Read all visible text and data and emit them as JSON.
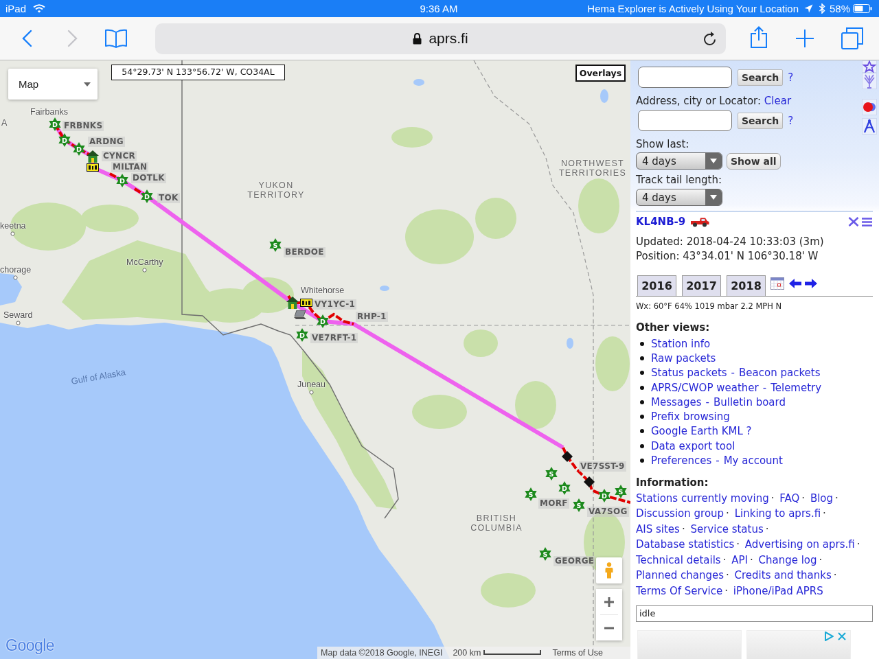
{
  "status_bar": {
    "device": "iPad",
    "time": "9:36 AM",
    "notice": "Hema Explorer is Actively Using Your Location",
    "battery": "58%"
  },
  "browser": {
    "nav": [
      {
        "kind": "back",
        "disabled": false
      },
      {
        "kind": "forward",
        "disabled": true
      }
    ],
    "address": "aprs.fi"
  },
  "map": {
    "type_menu": "Map",
    "coordinates": "54°29.73' N 133°56.72' W, CO34AL",
    "overlays": "Overlays",
    "places": [
      {
        "name": "Fairbanks",
        "kind": "city"
      },
      {
        "name": "A",
        "kind": "city"
      },
      {
        "name": "NORTHWEST TERRITORIES",
        "kind": "region"
      },
      {
        "name": "YUKON TERRITORY",
        "kind": "region"
      },
      {
        "name": "keetna",
        "kind": "town"
      },
      {
        "name": "McCarthy",
        "kind": "town"
      },
      {
        "name": "chorage",
        "kind": "town"
      },
      {
        "name": "Whitehorse",
        "kind": "city"
      },
      {
        "name": "Seward",
        "kind": "town"
      },
      {
        "name": "Gulf of Alaska",
        "kind": "water"
      },
      {
        "name": "Juneau",
        "kind": "town"
      },
      {
        "name": "BRITISH COLUMBIA",
        "kind": "region"
      }
    ],
    "station_labels": [
      "FRBNKS",
      "ARDNG",
      "CYNCR",
      "MILTAN",
      "DOTLK",
      "TOK",
      "BERDOE",
      "VY1YC-1",
      "RHP-1",
      "VE7RFT-1",
      "VE7SST-9",
      "MORF",
      "VA7SOG",
      "GEORGE"
    ],
    "markers": [
      {
        "kind": "star",
        "symbol": "D"
      },
      {
        "kind": "star",
        "symbol": "D"
      },
      {
        "kind": "star",
        "symbol": "D"
      },
      {
        "kind": "house"
      },
      {
        "kind": "box"
      },
      {
        "kind": "star",
        "symbol": "D"
      },
      {
        "kind": "star",
        "symbol": "D"
      },
      {
        "kind": "star",
        "symbol": "S"
      },
      {
        "kind": "house"
      },
      {
        "kind": "box"
      },
      {
        "kind": "laptop"
      },
      {
        "kind": "star",
        "symbol": "D"
      },
      {
        "kind": "star",
        "symbol": "D"
      },
      {
        "kind": "diamond"
      },
      {
        "kind": "star",
        "symbol": "S"
      },
      {
        "kind": "diamond"
      },
      {
        "kind": "star",
        "symbol": "D"
      },
      {
        "kind": "star",
        "symbol": "S"
      },
      {
        "kind": "star",
        "symbol": "S"
      },
      {
        "kind": "star",
        "symbol": "D"
      },
      {
        "kind": "star",
        "symbol": "S"
      },
      {
        "kind": "star",
        "symbol": "S"
      }
    ],
    "logo": "Google",
    "attribution": "Map data ©2018 Google, INEGI",
    "scale": "200 km",
    "terms": "Terms of Use"
  },
  "panel": {
    "tools": [
      {
        "kind": "star"
      },
      {
        "kind": "antenna"
      },
      {
        "kind": "circles"
      },
      {
        "kind": "compass"
      }
    ],
    "callsign_search": {
      "button": "Search",
      "help": "?"
    },
    "address_search": {
      "label": "Address, city or Locator:",
      "clear": "Clear",
      "button": "Search",
      "help": "?"
    },
    "show_last": {
      "label": "Show last:",
      "value": "4 days",
      "button": "Show all"
    },
    "track_tail": {
      "label": "Track tail length:",
      "value": "4 days"
    },
    "station": {
      "callsign": "KL4NB-9",
      "updated": "Updated: 2018-04-24 10:33:03 (3m)",
      "position": "Position: 43°34.01' N 106°30.18' W",
      "years": [
        "2016",
        "2017",
        "2018"
      ],
      "weather": "Wx: 60°F 64% 1019 mbar 2.2 MPH N"
    },
    "other_views": {
      "title": "Other views:",
      "separator": "-",
      "items": [
        {
          "links": [
            "Station info"
          ]
        },
        {
          "links": [
            "Raw packets"
          ]
        },
        {
          "links": [
            "Status packets",
            "Beacon packets"
          ]
        },
        {
          "links": [
            "APRS/CWOP weather",
            "Telemetry"
          ]
        },
        {
          "links": [
            "Messages",
            "Bulletin board"
          ]
        },
        {
          "links": [
            "Prefix browsing"
          ]
        },
        {
          "links": [
            "Google Earth KML ?"
          ]
        },
        {
          "links": [
            "Data export tool"
          ]
        },
        {
          "links": [
            "Preferences",
            "My account"
          ]
        }
      ]
    },
    "information": {
      "title": "Information:",
      "separator": "·",
      "links": [
        "Stations currently moving",
        "FAQ",
        "Blog",
        "Discussion group",
        "Linking to aprs.fi",
        "AIS sites",
        "Service status",
        "Database statistics",
        "Advertising on aprs.fi",
        "Technical details",
        "API",
        "Change log",
        "Planned changes",
        "Credits and thanks",
        "Terms Of Service",
        "iPhone/iPad APRS"
      ]
    },
    "status_field": {
      "value": "idle"
    },
    "ad": {
      "items": [
        {
          "kind": "photo"
        },
        {
          "kind": "photo"
        }
      ]
    }
  }
}
